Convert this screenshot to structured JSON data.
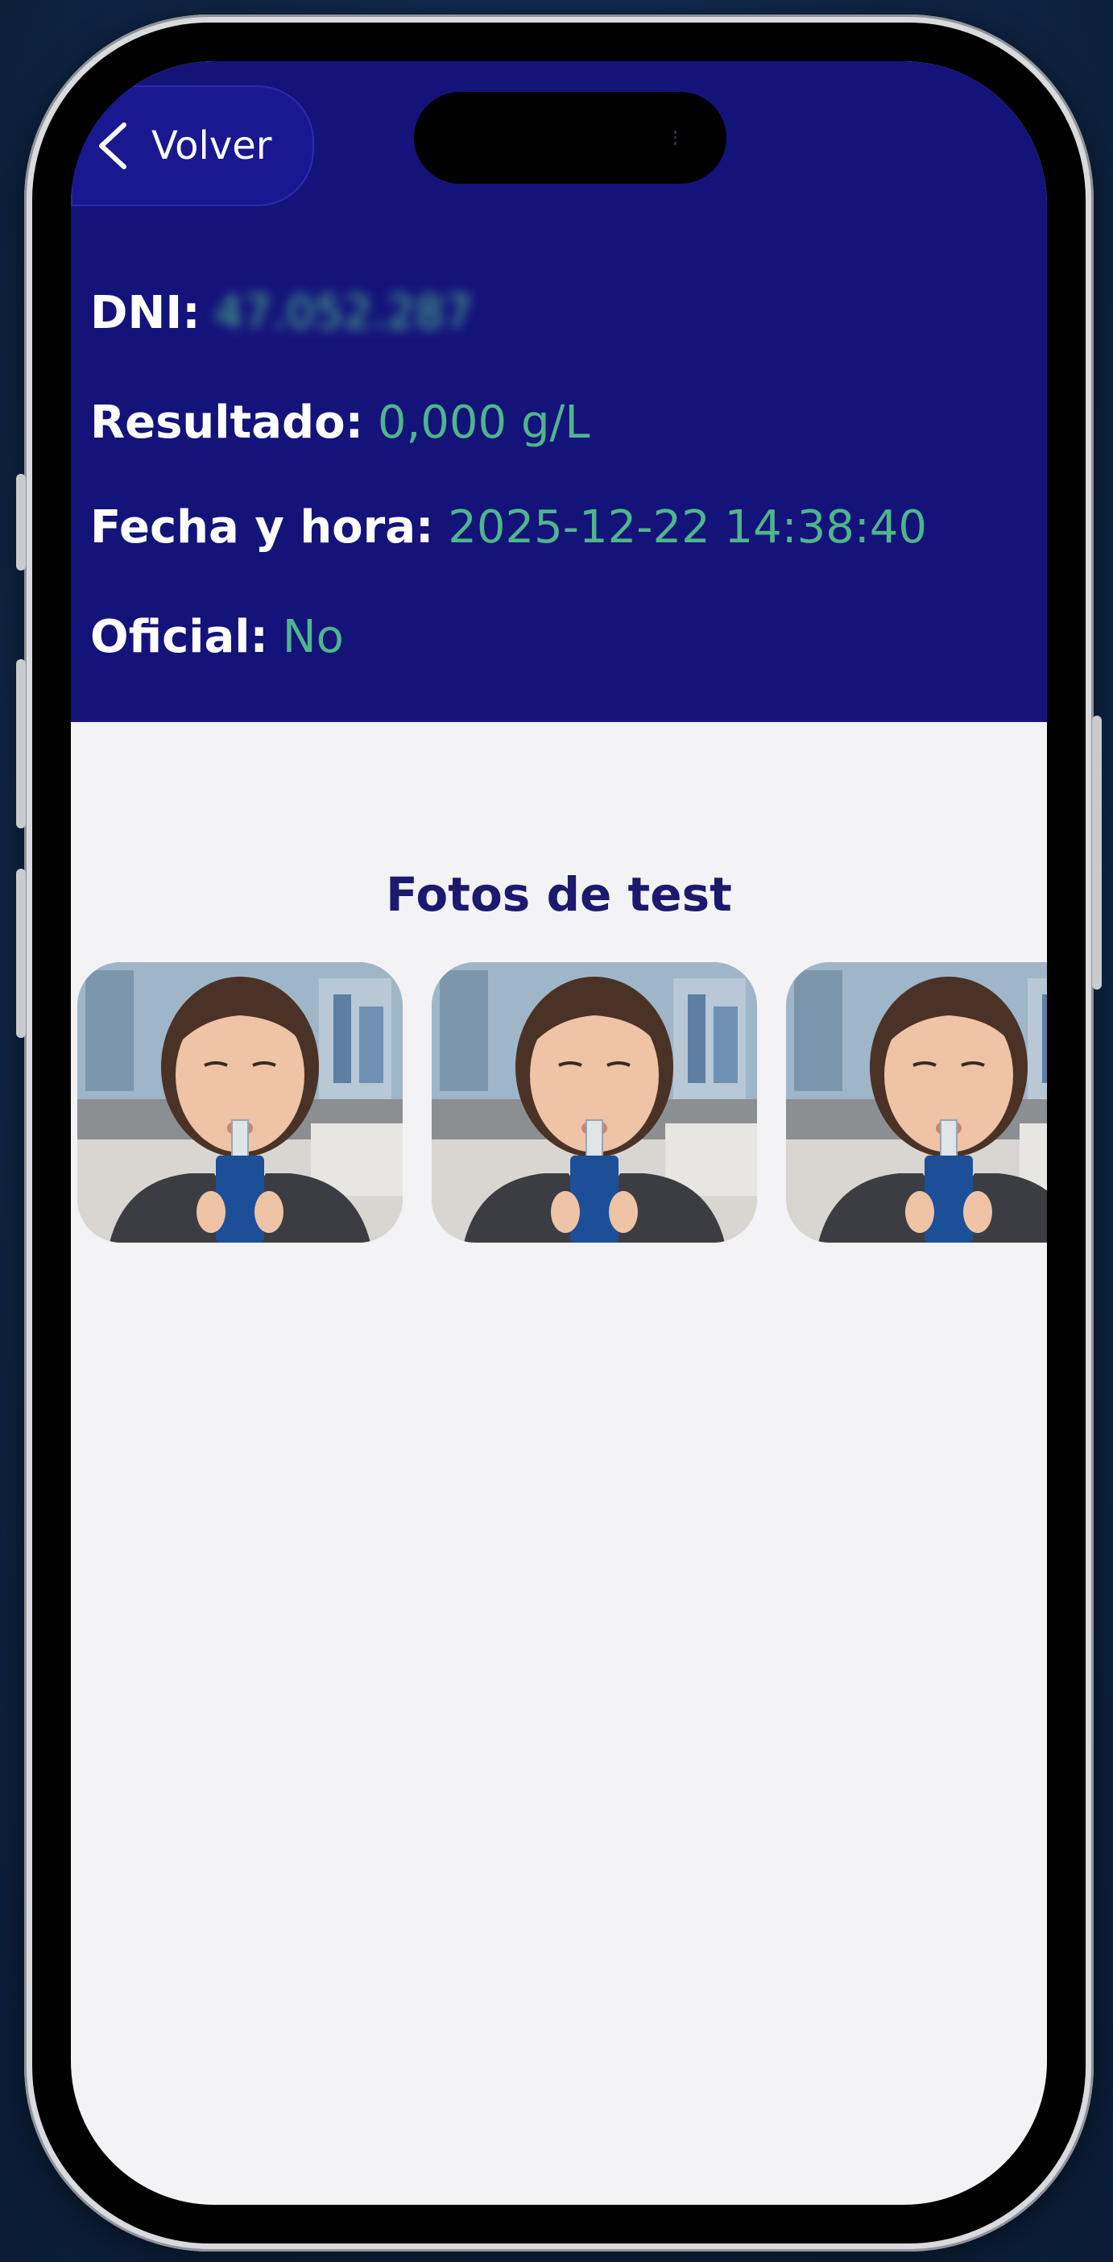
{
  "header": {
    "back_label": "Volver",
    "fields": [
      {
        "label": "DNI:",
        "value": "47.052.287"
      },
      {
        "label": "Resultado:",
        "value": "0,000 g/L"
      },
      {
        "label": "Fecha y hora:",
        "value": "2025-12-22 14:38:40"
      },
      {
        "label": "Oficial:",
        "value": "No"
      }
    ]
  },
  "photos": {
    "title": "Fotos de test",
    "items": [
      "breathalyzer-test-photo",
      "breathalyzer-test-photo",
      "breathalyzer-test-photo"
    ]
  },
  "colors": {
    "header_bg": "#14137a",
    "value_green": "#4fb58c",
    "title_navy": "#1c1a6e",
    "body_bg": "#f3f2f4"
  }
}
